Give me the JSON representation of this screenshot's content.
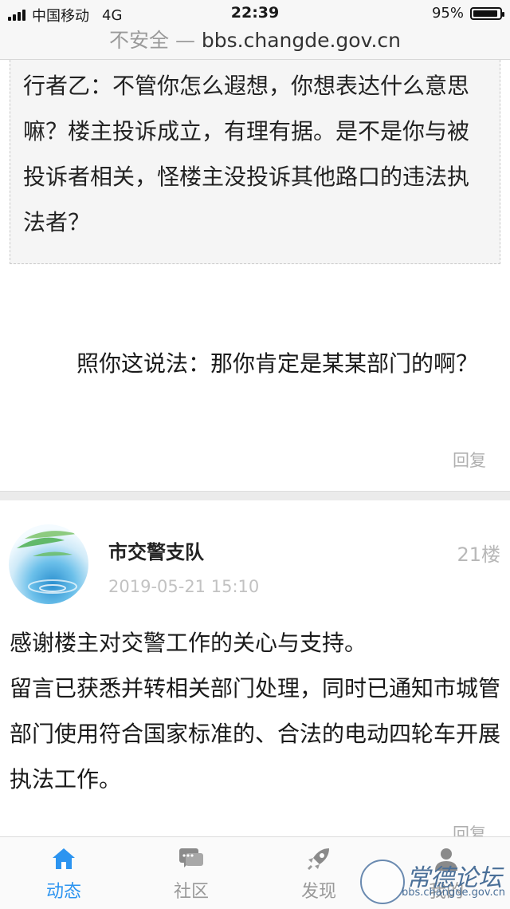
{
  "status_bar": {
    "carrier": "中国移动",
    "network": "4G",
    "time": "22:39",
    "battery_percent": "95%",
    "battery_level": 0.95
  },
  "browser": {
    "insecure_label": "不安全",
    "separator": "—",
    "url": "bbs.changde.gov.cn"
  },
  "previous_reply": {
    "quote": "行者乙：不管你怎么遐想，你想表达什么意思嘛？楼主投诉成立，有理有据。是不是你与被投诉者相关，怪楼主没投诉其他路口的违法执法者？",
    "body": "照你这说法：那你肯定是某某部门的啊？",
    "reply_label": "回复"
  },
  "post": {
    "author": "市交警支队",
    "floor": "21楼",
    "timestamp": "2019-05-21 15:10",
    "lines": [
      "感谢楼主对交警工作的关心与支持。",
      "留言已获悉并转相关部门处理，同时已通知市城管部门使用符合国家标准的、合法的电动四轮车开展执法工作。"
    ],
    "reply_label": "回复"
  },
  "tabbar": {
    "tabs": [
      {
        "label": "动态",
        "icon": "home-icon",
        "active": true
      },
      {
        "label": "社区",
        "icon": "chat-icon",
        "active": false
      },
      {
        "label": "发现",
        "icon": "rocket-icon",
        "active": false
      },
      {
        "label": "我的",
        "icon": "user-icon",
        "active": false
      }
    ]
  },
  "watermark": {
    "title": "常德论坛",
    "url": "bbs.changde.gov.cn"
  },
  "colors": {
    "accent": "#2c94f0",
    "muted": "#b0b0b0"
  }
}
